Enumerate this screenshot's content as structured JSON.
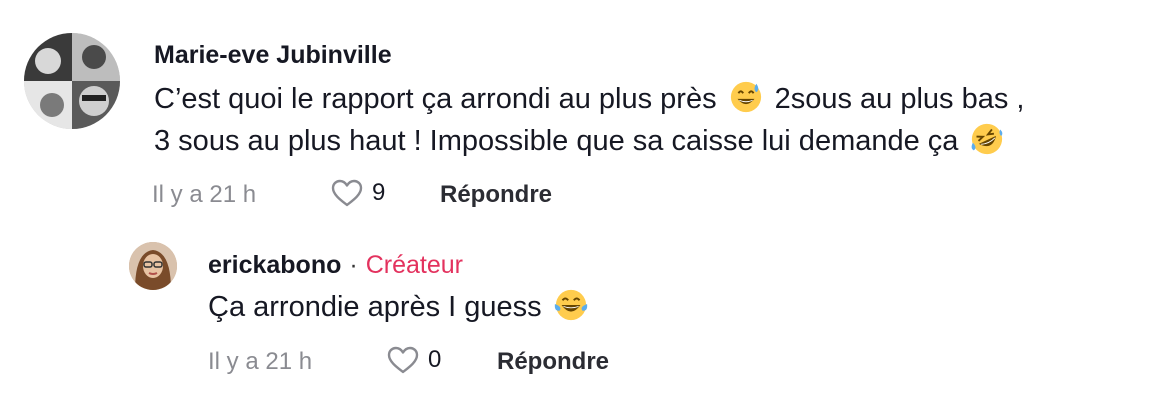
{
  "comments": [
    {
      "author": "Marie-eve Jubinville",
      "text_line1": "C’est quoi le rapport ça arrondi au plus près",
      "text_line1b": "2sous au plus bas ,",
      "text_line2": "3 sous au plus haut ! Impossible que sa caisse lui demande ça",
      "emoji1": "grinning-sweat-emoji",
      "emoji2": "rofl-emoji",
      "time": "Il y a 21 h",
      "likes": "9",
      "reply_label": "Répondre"
    }
  ],
  "replies": [
    {
      "author": "erickabono",
      "separator": "·",
      "badge": "Créateur",
      "text": "Ça arrondie après I guess",
      "emoji": "tears-of-joy-emoji",
      "time": "Il y a 21 h",
      "likes": "0",
      "reply_label": "Répondre"
    }
  ]
}
